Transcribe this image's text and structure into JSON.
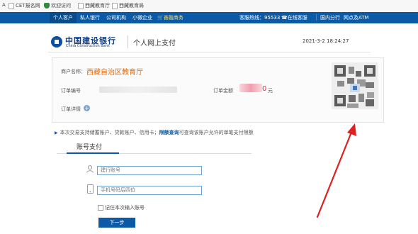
{
  "bookmarks": [
    {
      "label": "CET报名网",
      "icon": "doc-icon"
    },
    {
      "label": "欢迎访问",
      "icon": "shield-icon"
    },
    {
      "label": "西藏教育厅",
      "icon": "doc-icon"
    },
    {
      "label": "西藏教育局",
      "icon": "doc-icon"
    }
  ],
  "bookmarks_prefix": "A",
  "nav": {
    "left": [
      "个人客户",
      "私人银行",
      "公司机构",
      "小微企业",
      "善融商务"
    ],
    "hotline_label": "客服热线：95533",
    "right": [
      "在线客服",
      "国内分行",
      "网点及ATM"
    ]
  },
  "header": {
    "logo_cn": "中国建设银行",
    "logo_en": "China Construction Bank",
    "title": "个人网上支付",
    "timestamp": "2021-3-2 18:24:27"
  },
  "order": {
    "merchant_label": "商户名称：",
    "merchant_name": "西藏自治区教育厅",
    "order_no_label": "订单编号",
    "amount_label": "订单金额",
    "amount_tail": "0",
    "amount_unit": "元",
    "details_label": "订单详情"
  },
  "notice": {
    "prefix": "本次交易支持储蓄账户、贷款账户、信用卡；",
    "link": "限额查询",
    "suffix": "可查询该账户允许的单笔支付限额"
  },
  "tab": {
    "label": "账号支付"
  },
  "form": {
    "account_placeholder": "建行账号",
    "phone_placeholder": "手机号码后四位",
    "remember_label": "记住本次输入账号",
    "next_button": "下一步"
  },
  "colors": {
    "nav_blue": "#0c5aa6",
    "merchant_orange": "#e06d10",
    "arrow_red": "#e02020"
  }
}
